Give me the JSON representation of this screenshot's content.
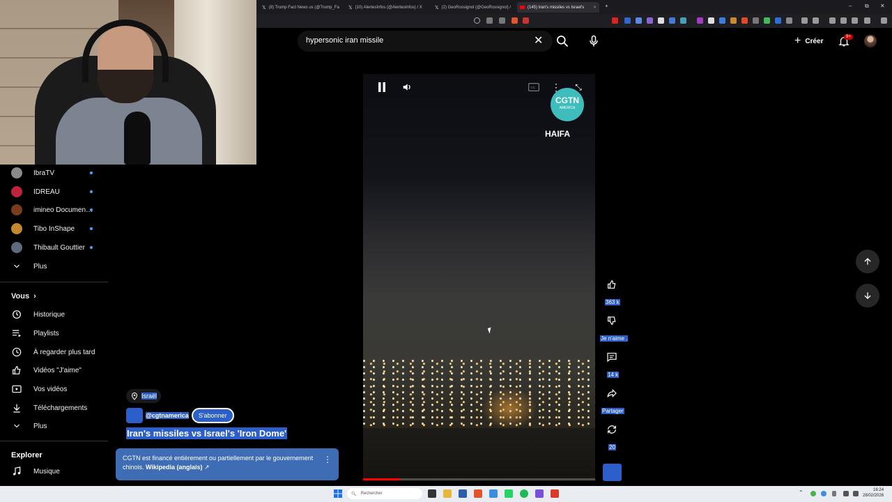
{
  "browser": {
    "tabs": [
      {
        "label": "(8) Trump Fact News us (@Trump_Fa",
        "icon": "x-logo-icon"
      },
      {
        "label": "(10) AlertesInfos (@AlertesInfos) / X",
        "icon": "x-logo-icon"
      },
      {
        "label": "(2) GeoRossignol (@GeoRossignol) /",
        "icon": "x-logo-icon"
      },
      {
        "label": "(145) Iran's missiles vs Israel's",
        "icon": "youtube-icon",
        "active": true
      }
    ],
    "window_controls": [
      "–",
      "⧉",
      "✕"
    ]
  },
  "topbar": {
    "search_query": "hypersonic iran missile",
    "create_label": "Créer",
    "notif_badge": "9+"
  },
  "sidebar": {
    "subscriptions": [
      {
        "name": "IbraTV",
        "color": "#8a8a8a"
      },
      {
        "name": "IDREAU",
        "color": "#c0233b"
      },
      {
        "name": "imineo Documen…",
        "color": "#7a3c1c"
      },
      {
        "name": "Tibo InShape",
        "color": "#c4872e"
      },
      {
        "name": "Thibault Gouttier",
        "color": "#5d6b7d"
      }
    ],
    "more_label_1": "Plus",
    "you_header": "Vous",
    "you_items": [
      {
        "label": "Historique",
        "icon": "history-icon"
      },
      {
        "label": "Playlists",
        "icon": "playlists-icon"
      },
      {
        "label": "À regarder plus tard",
        "icon": "watch-later-icon"
      },
      {
        "label": "Vidéos \"J'aime\"",
        "icon": "liked-videos-icon"
      },
      {
        "label": "Vos vidéos",
        "icon": "your-videos-icon"
      },
      {
        "label": "Téléchargements",
        "icon": "downloads-icon"
      }
    ],
    "more_label_2": "Plus",
    "explore_header": "Explorer",
    "explore_items": [
      {
        "label": "Musique",
        "icon": "music-icon"
      }
    ]
  },
  "short": {
    "location": "Israël",
    "channel": "@cgtnamerica",
    "subscribe_label": "S'abonner",
    "title": "Iran's missiles vs Israel's 'Iron Dome'",
    "info_text": "CGTN est financé entièrement ou partiellement par le gouvernement chinois.",
    "info_link": "Wikipedia (anglais)",
    "watermark_main": "CGTN",
    "watermark_sub": "AMERICA",
    "overlay_caption": "HAIFA",
    "progress": 0.16,
    "likes": "363 k",
    "dislike_label": "Je n'aime .",
    "comments": "14 k",
    "share_label": "Partager",
    "remix_count": "20"
  },
  "taskbar": {
    "search_placeholder": "Rechercher",
    "time": "16:24",
    "date": "28/02/2026"
  },
  "colors": {
    "accent_selection": "#2c5fc9",
    "youtube_red": "#ff0000",
    "cgtn_teal": "#3fbcbc"
  }
}
